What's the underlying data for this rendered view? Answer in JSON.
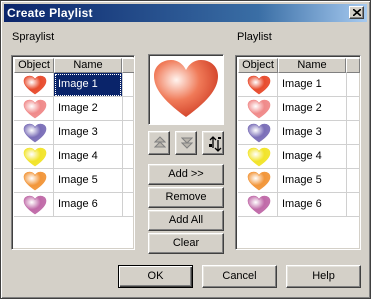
{
  "window": {
    "title": "Create Playlist"
  },
  "spraylist": {
    "label": "Spraylist",
    "columns": [
      "Object",
      "Name"
    ],
    "rows": [
      {
        "name": "Image 1",
        "color": "#e84c2e",
        "selected": true
      },
      {
        "name": "Image 2",
        "color": "#f08a8a",
        "selected": false
      },
      {
        "name": "Image 3",
        "color": "#7b6fb8",
        "selected": false
      },
      {
        "name": "Image 4",
        "color": "#f2e42a",
        "selected": false
      },
      {
        "name": "Image 5",
        "color": "#f2963a",
        "selected": false
      },
      {
        "name": "Image 6",
        "color": "#c06aa8",
        "selected": false
      }
    ]
  },
  "playlist": {
    "label": "Playlist",
    "columns": [
      "Object",
      "Name"
    ],
    "rows": [
      {
        "name": "Image 1",
        "color": "#e84c2e"
      },
      {
        "name": "Image 2",
        "color": "#f08a8a"
      },
      {
        "name": "Image 3",
        "color": "#7b6fb8"
      },
      {
        "name": "Image 4",
        "color": "#f2e42a"
      },
      {
        "name": "Image 5",
        "color": "#f2963a"
      },
      {
        "name": "Image 6",
        "color": "#c06aa8"
      }
    ]
  },
  "preview": {
    "icon": "heart-icon",
    "color": "#e84c2e"
  },
  "middle_buttons": {
    "move_up_icon": "move-up-icon",
    "move_down_icon": "move-down-icon",
    "shuffle_icon": "shuffle-icon",
    "add": "Add >>",
    "remove": "Remove",
    "add_all": "Add All",
    "clear": "Clear"
  },
  "footer": {
    "ok": "OK",
    "cancel": "Cancel",
    "help": "Help"
  }
}
